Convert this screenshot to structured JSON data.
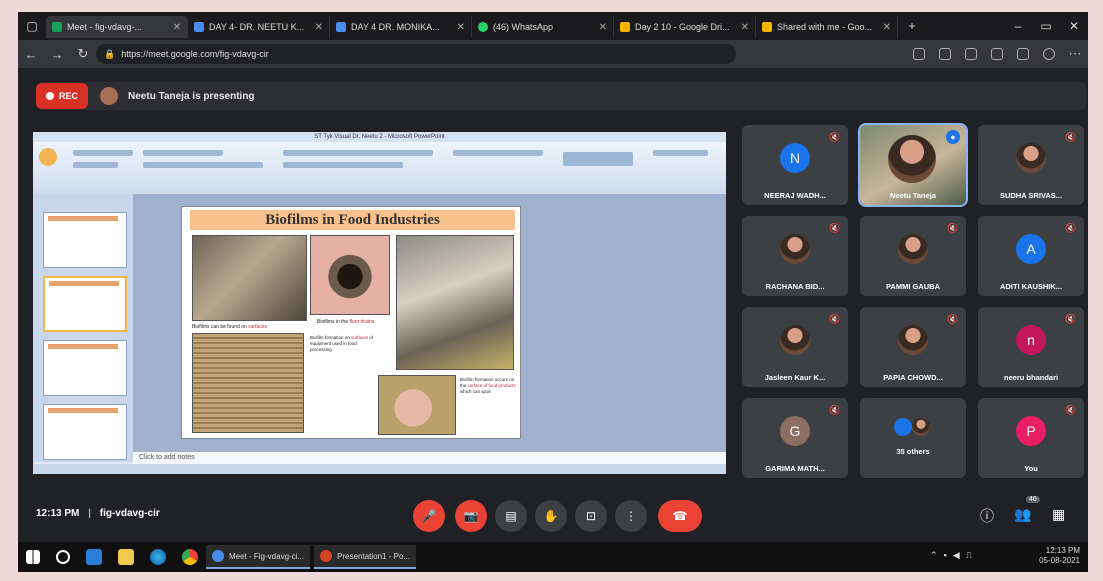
{
  "browser": {
    "tabs": [
      {
        "label": "Meet - fig-vdavg-...",
        "color": "#1a9e5f",
        "active": true
      },
      {
        "label": "DAY 4- DR. NEETU K...",
        "color": "#4a8ce8"
      },
      {
        "label": "DAY 4 DR. MONIKA...",
        "color": "#4a8ce8"
      },
      {
        "label": "(46) WhatsApp",
        "color": "#25d366"
      },
      {
        "label": "Day 2 10 - Google Dri...",
        "color": "#f4b400"
      },
      {
        "label": "Shared with me - Goo...",
        "color": "#f4b400"
      }
    ],
    "new_tab": "+",
    "url": "https://meet.google.com/fig-vdavg-cir"
  },
  "banner": {
    "rec_label": "REC",
    "presenting_text": "Neetu Taneja is presenting"
  },
  "screen": {
    "window_title": "ST Tyk Visual Dr. Neetu 2 - Microsoft PowerPoint",
    "notes_placeholder": "Click to add notes",
    "slide": {
      "title": "Biofilms in Food Industries",
      "caption1_a": "Biofilms can be found on ",
      "caption1_b": "surfaces",
      "caption2_a": "Biofilms in the ",
      "caption2_b": "floor drains",
      "caption3_a": "Biofilm formation on ",
      "caption3_b": "surfaces",
      "caption3_c": " of equipment used in food processing",
      "caption4_a": "Biofilm formation occurs on the ",
      "caption4_b": "surface of food products",
      "caption4_c": " which can spoil"
    }
  },
  "participants": [
    {
      "name": "NEERAJ WADH...",
      "initial": "N",
      "color": "#1a73e8"
    },
    {
      "name": "Neetu Taneja",
      "initial": "",
      "color": "#5a7a5a",
      "photo": true,
      "active": true
    },
    {
      "name": "SUDHA SRIVAS...",
      "initial": "",
      "color": "#6b4a3a",
      "photo": true
    },
    {
      "name": "RACHANA BID...",
      "initial": "",
      "color": "#6b4a3a",
      "photo": true
    },
    {
      "name": "PAMMI GAUBA",
      "initial": "",
      "color": "#6b4a3a",
      "photo": true
    },
    {
      "name": "ADITI KAUSHIK...",
      "initial": "A",
      "color": "#1a73e8"
    },
    {
      "name": "Jasleen Kaur K...",
      "initial": "",
      "color": "#6b4a3a",
      "photo": true
    },
    {
      "name": "PAPIA CHOWD...",
      "initial": "",
      "color": "#6b4a3a",
      "photo": true
    },
    {
      "name": "neeru bhandari",
      "initial": "n",
      "color": "#c2185b"
    },
    {
      "name": "GARIMA MATH...",
      "initial": "G",
      "color": "#8d6e63"
    },
    {
      "name": "35 others",
      "initial": "",
      "color": "#3c4043",
      "others": true
    },
    {
      "name": "You",
      "initial": "P",
      "color": "#e91e63"
    }
  ],
  "meeting": {
    "time": "12:13 PM",
    "separator": "|",
    "code": "fig-vdavg-cir",
    "people_count": "46"
  },
  "taskbar": {
    "apps": [
      {
        "label": "Meet - Fig-vdavg-ci...",
        "color": "#4a8ce8"
      },
      {
        "label": "Presentation1 - Po...",
        "color": "#d04423"
      }
    ],
    "clock_time": "12:13 PM",
    "clock_date": "05-08-2021"
  }
}
